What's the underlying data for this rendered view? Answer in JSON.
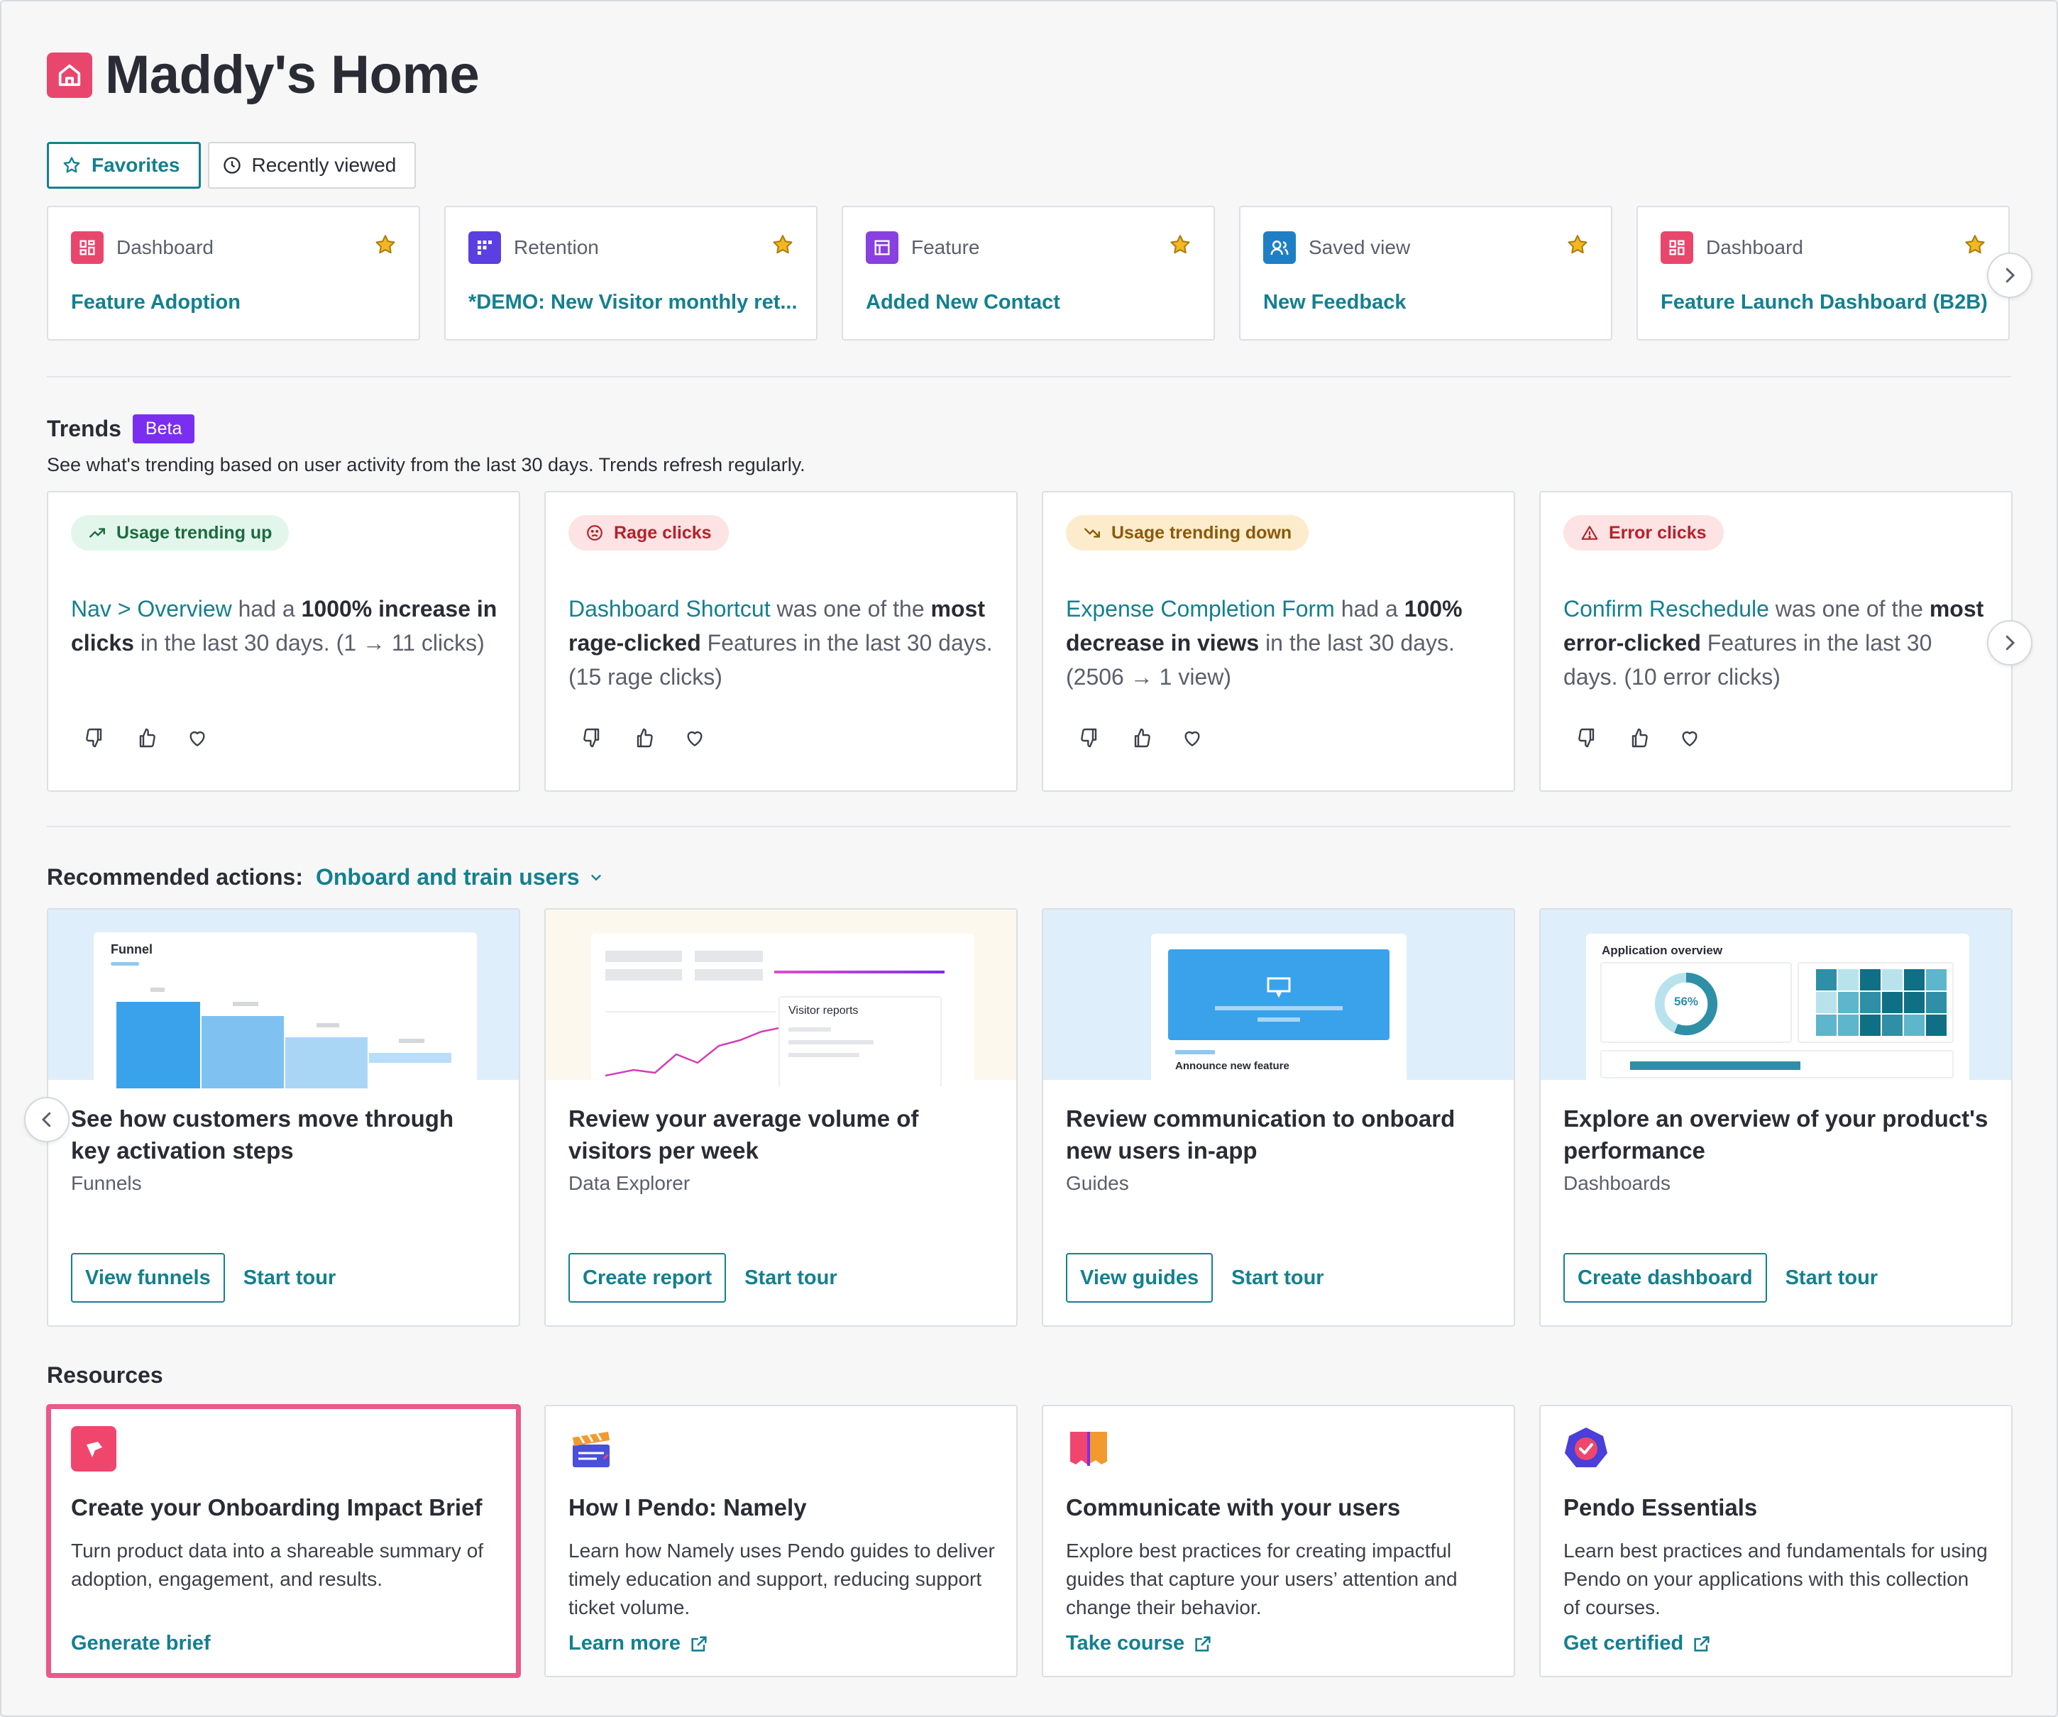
{
  "header": {
    "title": "Maddy's Home"
  },
  "tabs": [
    {
      "label": "Favorites",
      "active": true
    },
    {
      "label": "Recently viewed",
      "active": false
    }
  ],
  "favorites": [
    {
      "type": "Dashboard",
      "name": "Feature Adoption",
      "icon": "dashboard-icon",
      "color": "#e9466d"
    },
    {
      "type": "Retention",
      "name": "*DEMO: New Visitor monthly ret...",
      "icon": "retention-icon",
      "color": "#5b3fe0"
    },
    {
      "type": "Feature",
      "name": "Added New Contact",
      "icon": "feature-icon",
      "color": "#8a3fe0"
    },
    {
      "type": "Saved view",
      "name": "New Feedback",
      "icon": "saved-view-icon",
      "color": "#1e7fc4"
    },
    {
      "type": "Dashboard",
      "name": "Feature Launch Dashboard (B2B)",
      "icon": "dashboard-icon",
      "color": "#e9466d"
    }
  ],
  "trends": {
    "title": "Trends",
    "badge": "Beta",
    "subtitle": "See what's trending based on user activity from the last 30 days. Trends refresh regularly.",
    "cards": [
      {
        "pill": "Usage trending up",
        "link": "Nav > Overview",
        "t1": " had a ",
        "bold": "1000% increase in clicks",
        "t2": " in the last 30 days. ",
        "detail": "(1 → 11 clicks)"
      },
      {
        "pill": "Rage clicks",
        "link": "Dashboard Shortcut",
        "t1": " was one of the ",
        "bold": "most rage-clicked",
        "t2": " Features in the last 30 days. ",
        "detail": "(15 rage clicks)"
      },
      {
        "pill": "Usage trending down",
        "link": "Expense Completion Form",
        "t1": " had a ",
        "bold": "100% decrease in views",
        "t2": " in the last 30 days. ",
        "detail": "(2506 → 1 view)"
      },
      {
        "pill": "Error clicks",
        "link": "Confirm Reschedule",
        "t1": " was one of the ",
        "bold": "most error-clicked",
        "t2": " Features in the last 30 days. ",
        "detail": "(10 error clicks)"
      }
    ]
  },
  "recommended": {
    "label": "Recommended actions:",
    "selected": "Onboard and train users",
    "cards": [
      {
        "heading": "See how customers move through key activation steps",
        "sub": "Funnels",
        "primary": "View funnels",
        "secondary": "Start tour",
        "hero_label": "Funnel"
      },
      {
        "heading": "Review your average volume of visitors per week",
        "sub": "Data Explorer",
        "primary": "Create report",
        "secondary": "Start tour",
        "hero_label": "Visitor reports"
      },
      {
        "heading": "Review communication to onboard new users in-app",
        "sub": "Guides",
        "primary": "View guides",
        "secondary": "Start tour",
        "hero_label": "Announce new feature"
      },
      {
        "heading": "Explore an overview of your product's performance",
        "sub": "Dashboards",
        "primary": "Create dashboard",
        "secondary": "Start tour",
        "hero_label": "Application overview",
        "hero_value": "56%"
      }
    ]
  },
  "resources": {
    "title": "Resources",
    "cards": [
      {
        "heading": "Create your Onboarding Impact Brief",
        "desc": "Turn product data into a shareable summary of adoption, engagement, and results.",
        "link": "Generate brief"
      },
      {
        "heading": "How I Pendo: Namely",
        "desc": "Learn how Namely uses Pendo guides to deliver timely education and support, reducing support ticket volume.",
        "link": "Learn more"
      },
      {
        "heading": "Communicate with your users",
        "desc": "Explore best practices for creating impactful guides that capture your users’ attention and change their behavior.",
        "link": "Take course"
      },
      {
        "heading": "Pendo Essentials",
        "desc": "Learn best practices and fundamentals for using Pendo on your applications with this collection of courses.",
        "link": "Get certified"
      }
    ]
  },
  "colors": {
    "accent": "#13808f",
    "brand": "#e9466d",
    "beta": "#7a2ef0",
    "highlight": "#e95a8a"
  }
}
